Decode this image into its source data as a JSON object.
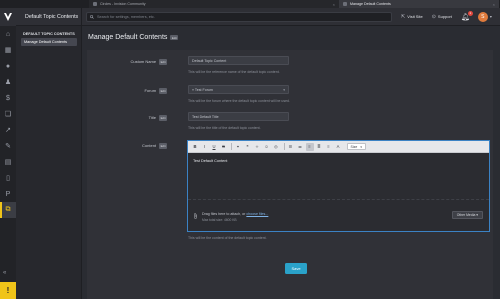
{
  "browser": {
    "tabs": [
      {
        "label": "Circles - Invision Community",
        "active": false
      },
      {
        "label": "Manage Default Contents",
        "active": true
      }
    ]
  },
  "rail": {
    "icons": [
      "home-icon",
      "grid-icon",
      "chat-icon",
      "user-icon",
      "dollar-icon",
      "layers-icon",
      "chart-icon",
      "brush-icon",
      "server-icon",
      "file-icon",
      "pages-icon",
      "copy-icon"
    ],
    "active_index": 11,
    "collapse_label": "«",
    "warning_label": "!"
  },
  "sidebar": {
    "title": "Default Topic Contents",
    "group_label": "DEFAULT TOPIC CONTENTS",
    "items": [
      {
        "label": "Manage Default Contents",
        "active": true
      }
    ]
  },
  "topbar": {
    "search_placeholder": "Search for settings, members, etc.",
    "visit_site": "Visit Site",
    "support": "Support",
    "notification_count": "1",
    "avatar_initial": "S"
  },
  "page": {
    "title": "Manage Default Contents",
    "title_tag": "Edit"
  },
  "form": {
    "custom_name": {
      "label": "Custom Name",
      "tag": "Edit",
      "value": "Default Topic Content",
      "help": "This will be the reference name of the default topic content."
    },
    "forum": {
      "label": "Forum",
      "tag": "Edit",
      "value": "» Test Forum",
      "help": "This will be the forum where the default topic content will be used."
    },
    "title": {
      "label": "Title",
      "tag": "Edit",
      "value": "Test Default Title",
      "help": "This will be the title of the default topic content."
    },
    "content": {
      "label": "Content",
      "tag": "Edit",
      "body": "Test Default Content",
      "size_label": "Size",
      "drop_text": "Drag files here to attach, or ",
      "choose_files": "choose files...",
      "max_size": "Max total size: 4600 KB",
      "other_media": "Other Media ▾",
      "help": "This will be the content of the default topic content."
    },
    "save_label": "Save"
  },
  "colors": {
    "accent": "#f0c419",
    "save_button": "#2aa2c9",
    "editor_border": "#3b82c4"
  }
}
